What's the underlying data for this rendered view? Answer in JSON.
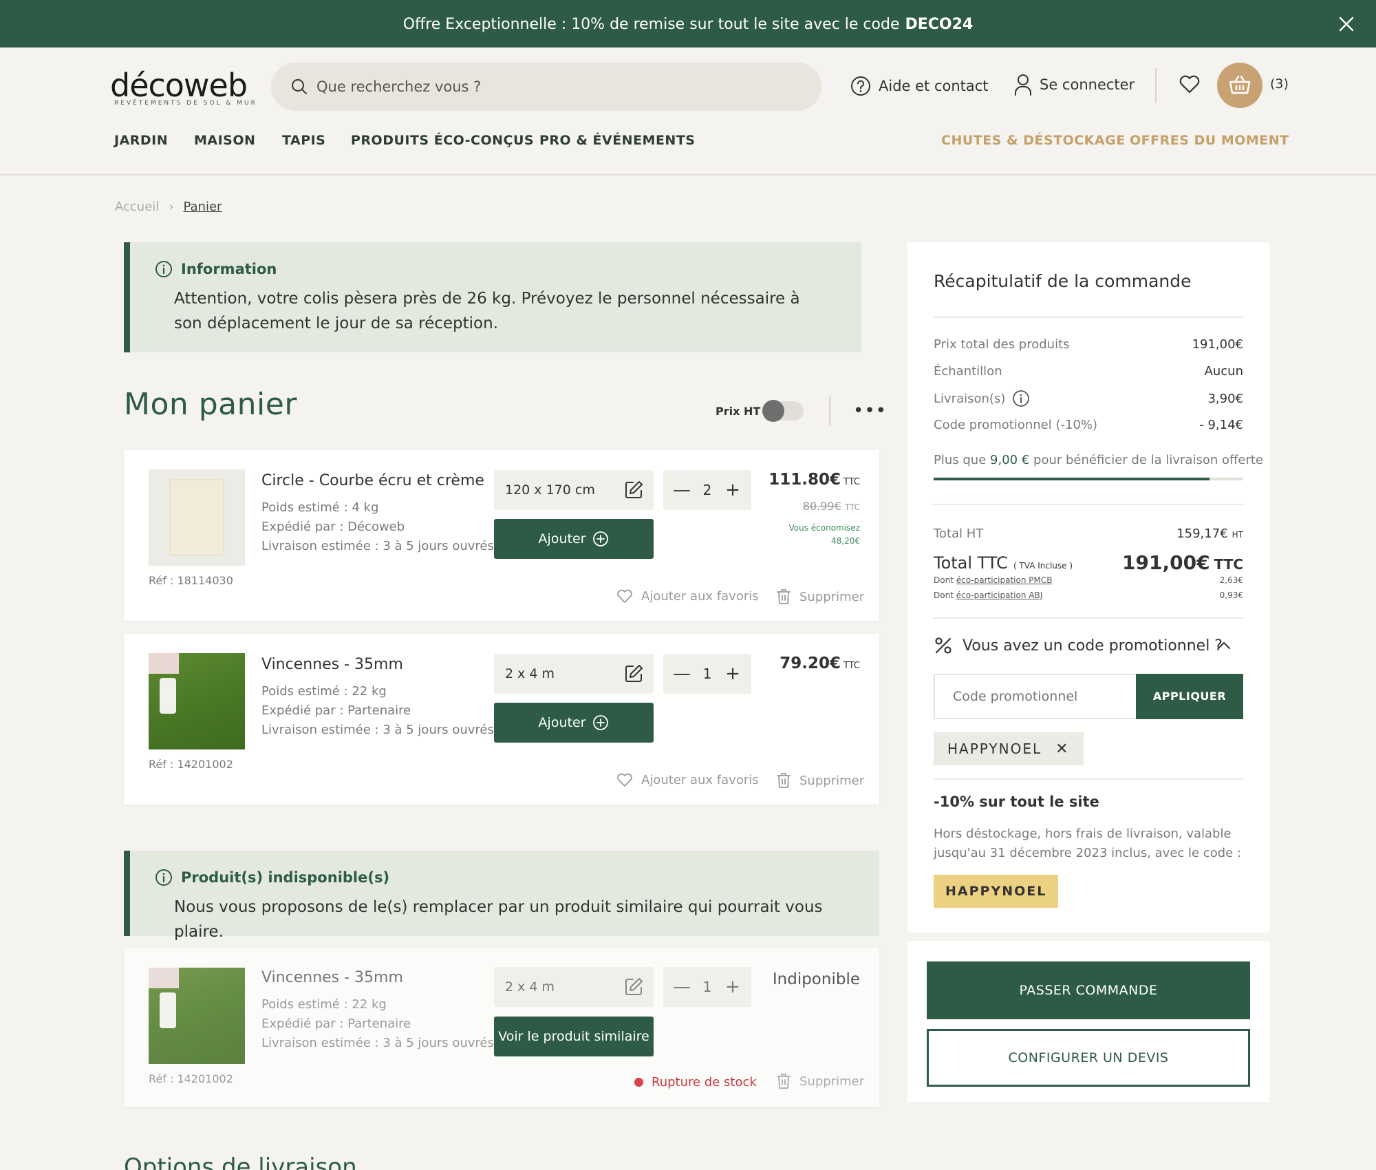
{
  "banner": {
    "text": "Offre Exceptionnelle : 10% de remise sur tout le site avec le code",
    "code": "DECO24"
  },
  "header": {
    "logo": "décoweb",
    "logo_tagline": "REVÊTEMENTS DE SOL & MUR",
    "search_placeholder": "Que recherchez vous ?",
    "help": "Aide et contact",
    "login": "Se connecter",
    "cart_count": "(3)"
  },
  "nav": {
    "jardin": "JARDIN",
    "maison": "MAISON",
    "tapis": "TAPIS",
    "eco": "PRODUITS ÉCO-CONÇUS",
    "pro": "PRO & ÉVÉNEMENTS",
    "chutes": "CHUTES & DÉSTOCKAGE",
    "offres": "OFFRES DU MOMENT"
  },
  "breadcrumb": {
    "home": "Accueil",
    "sep": "›",
    "current": "Panier"
  },
  "info": {
    "title": "Information",
    "text": "Attention, votre colis pèsera près de 26 kg. Prévoyez le personnel nécessaire à son déplacement le jour de sa réception."
  },
  "cart": {
    "title": "Mon panier",
    "prix_ht": "Prix HT",
    "more": "•••"
  },
  "items": [
    {
      "name": "Circle - Courbe écru et crème",
      "weight": "Poids estimé : 4 kg",
      "shipper": "Expédié par : Décoweb",
      "delivery": "Livraison estimée : 3 à 5 jours ouvrés",
      "ref": "Réf : 18114030",
      "size": "120 x 170 cm",
      "qty": "2",
      "price": "111.80€",
      "ttc": "TTC",
      "old_price": "80.99€",
      "save_label": "Vous économisez",
      "save_value": "48,20€",
      "add_label": "Ajouter",
      "fav_label": "Ajouter aux favoris",
      "delete_label": "Supprimer"
    },
    {
      "name": "Vincennes - 35mm",
      "weight": "Poids estimé : 22 kg",
      "shipper": "Expédié par : Partenaire",
      "delivery": "Livraison estimée : 3 à 5 jours ouvrés",
      "ref": "Réf : 14201002",
      "size": "2 x 4 m",
      "qty": "1",
      "price": "79.20€",
      "ttc": "TTC",
      "add_label": "Ajouter",
      "fav_label": "Ajouter aux favoris",
      "delete_label": "Supprimer"
    }
  ],
  "unavailable": {
    "title": "Produit(s) indisponible(s)",
    "text": "Nous vous proposons de le(s) remplacer par un produit similaire qui pourrait vous plaire.",
    "item": {
      "name": "Vincennes - 35mm",
      "weight": "Poids estimé : 22 kg",
      "shipper": "Expédié par : Partenaire",
      "delivery": "Livraison estimée : 3 à 5 jours ouvrés",
      "ref": "Réf : 14201002",
      "size": "2 x 4 m",
      "qty": "1",
      "status": "Indiponible",
      "similar_label": "Voir le produit similaire",
      "stock_label": "Rupture de stock",
      "delete_label": "Supprimer"
    }
  },
  "summary": {
    "title": "Récapitulatif de la commande",
    "rows": [
      {
        "label": "Prix total des produits",
        "value": "191,00€"
      },
      {
        "label": "Échantillon",
        "value": "Aucun"
      },
      {
        "label": "Livraison(s)",
        "value": "3,90€"
      },
      {
        "label": "Code promotionnel (-10%)",
        "value": "- 9,14€"
      }
    ],
    "free_ship_prefix": "Plus que",
    "free_ship_amount": "9,00 €",
    "free_ship_suffix": "pour bénéficier de la livraison offerte",
    "free_ship_progress": 0.89,
    "total_ht_label": "Total HT",
    "total_ht_value": "159,17€",
    "ht_unit": "HT",
    "total_ttc_label": "Total TTC",
    "tva_note": "( TVA Incluse )",
    "total_ttc_value": "191,00€",
    "ttc_unit": "TTC",
    "eco1_prefix": "Dont",
    "eco1_link": "éco-participation PMCB",
    "eco1_value": "2,63€",
    "eco2_prefix": "Dont",
    "eco2_link": "éco-participation ABJ",
    "eco2_value": "0,93€",
    "promo_question": "Vous avez un code promotionnel ?",
    "promo_placeholder": "Code promotionnel",
    "apply": "APPLIQUER",
    "applied_code": "HAPPYNOEL",
    "offer_title": "-10% sur tout le site",
    "offer_text": "Hors déstockage, hors frais de livraison, valable jusqu'au 31 décembre 2023 inclus, avec le code :",
    "offer_code": "HAPPYNOEL"
  },
  "actions": {
    "order": "PASSER COMMANDE",
    "quote": "CONFIGURER UN DEVIS"
  },
  "delivery_options_title": "Options de livraison",
  "colors": {
    "primary": "#2e5b45",
    "gold": "#c5a06a",
    "cart_badge": "#c9a274",
    "highlight": "#ecd183",
    "error": "#d9434b"
  }
}
